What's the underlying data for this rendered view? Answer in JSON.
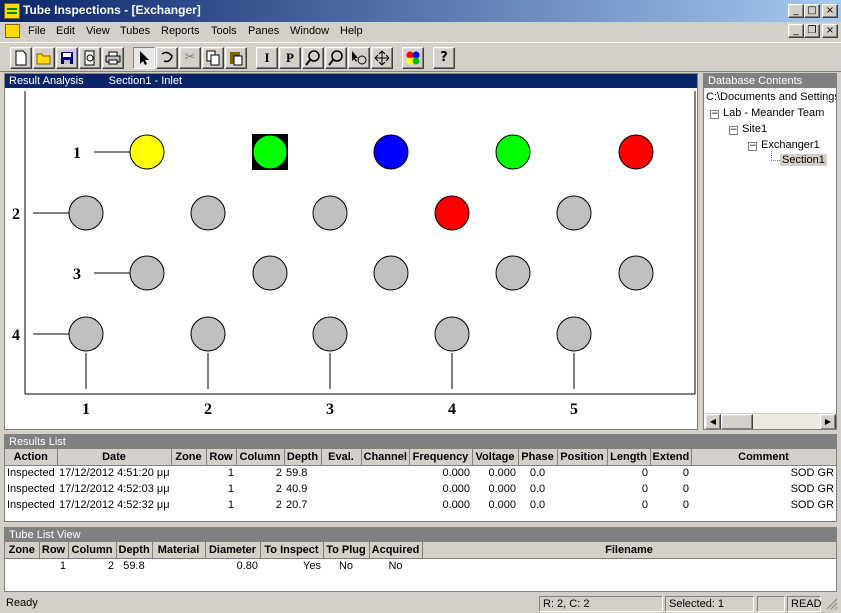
{
  "window": {
    "title": "Tube Inspections - [Exchanger]"
  },
  "caption_buttons": {
    "minimize": "_",
    "maximize": "□",
    "close": "×",
    "restore": "❐"
  },
  "menu": [
    "File",
    "Edit",
    "View",
    "Tubes",
    "Reports",
    "Tools",
    "Panes",
    "Window",
    "Help"
  ],
  "toolbar": {
    "icons": [
      "new-icon",
      "open-icon",
      "save-icon",
      "print-preview-icon",
      "print-icon",
      "pointer-icon",
      "lasso-icon",
      "cut-icon",
      "copy-icon",
      "paste-icon",
      "inspect-icon",
      "plug-icon",
      "zoom-in-icon",
      "zoom-out-icon",
      "select-zoom-icon",
      "pan-icon",
      "colors-icon",
      "help-icon"
    ],
    "inspect_label": "I",
    "plug_label": "P",
    "help_label": "?"
  },
  "result_pane": {
    "title": "Result Analysis",
    "section": "Section1 - Inlet",
    "rows": [
      {
        "label": "1",
        "offset": false,
        "tubes": [
          "#ffff00",
          "#00ff00",
          "#0000ff",
          "#00ff00",
          "#ff0000"
        ],
        "selected_index": 1
      },
      {
        "label": "2",
        "offset": true,
        "tubes": [
          "#c0c0c0",
          "#c0c0c0",
          "#c0c0c0",
          "#ff0000",
          "#c0c0c0"
        ],
        "selected_index": -1
      },
      {
        "label": "3",
        "offset": false,
        "tubes": [
          "#c0c0c0",
          "#c0c0c0",
          "#c0c0c0",
          "#c0c0c0",
          "#c0c0c0"
        ],
        "selected_index": -1
      },
      {
        "label": "4",
        "offset": true,
        "tubes": [
          "#c0c0c0",
          "#c0c0c0",
          "#c0c0c0",
          "#c0c0c0",
          "#c0c0c0"
        ],
        "selected_index": -1
      }
    ],
    "columns": [
      "1",
      "2",
      "3",
      "4",
      "5"
    ]
  },
  "db_pane": {
    "title": "Database Contents",
    "tree": [
      {
        "label": "C:\\Documents and Settings",
        "box": ""
      },
      {
        "label": "Lab - Meander Team",
        "box": "−"
      },
      {
        "label": "Site1",
        "box": "−"
      },
      {
        "label": "Exchanger1",
        "box": "−"
      },
      {
        "label": "Section1",
        "box": ""
      }
    ]
  },
  "results_list": {
    "title": "Results List",
    "columns": [
      "Action",
      "Date",
      "Zone",
      "Row",
      "Column",
      "Depth",
      "Eval.",
      "Channel",
      "Frequency",
      "Voltage",
      "Phase",
      "Position",
      "Length",
      "Extend",
      "Comment"
    ],
    "rows": [
      [
        "Inspected",
        "17/12/2012 4:51:20 μμ",
        "",
        "1",
        "2",
        "59.8",
        "",
        "",
        "0.000",
        "0.000",
        "0.0",
        "",
        "0",
        "0",
        "SOD GR"
      ],
      [
        "Inspected",
        "17/12/2012 4:52:03 μμ",
        "",
        "1",
        "2",
        "40.9",
        "",
        "",
        "0.000",
        "0.000",
        "0.0",
        "",
        "0",
        "0",
        "SOD GR"
      ],
      [
        "Inspected",
        "17/12/2012 4:52:32 μμ",
        "",
        "1",
        "2",
        "20.7",
        "",
        "",
        "0.000",
        "0.000",
        "0.0",
        "",
        "0",
        "0",
        "SOD GR"
      ]
    ]
  },
  "tube_list": {
    "title": "Tube List View",
    "columns": [
      "Zone",
      "Row",
      "Column",
      "Depth",
      "Material",
      "Diameter",
      "To Inspect",
      "To Plug",
      "Acquired",
      "Filename"
    ],
    "rows": [
      [
        "",
        "1",
        "2",
        "59.8",
        "",
        "0.80",
        "Yes",
        "No",
        "No",
        ""
      ]
    ]
  },
  "status": {
    "ready": "Ready",
    "position": "R: 2, C: 2",
    "selected": "Selected: 1",
    "mode": "READ"
  }
}
